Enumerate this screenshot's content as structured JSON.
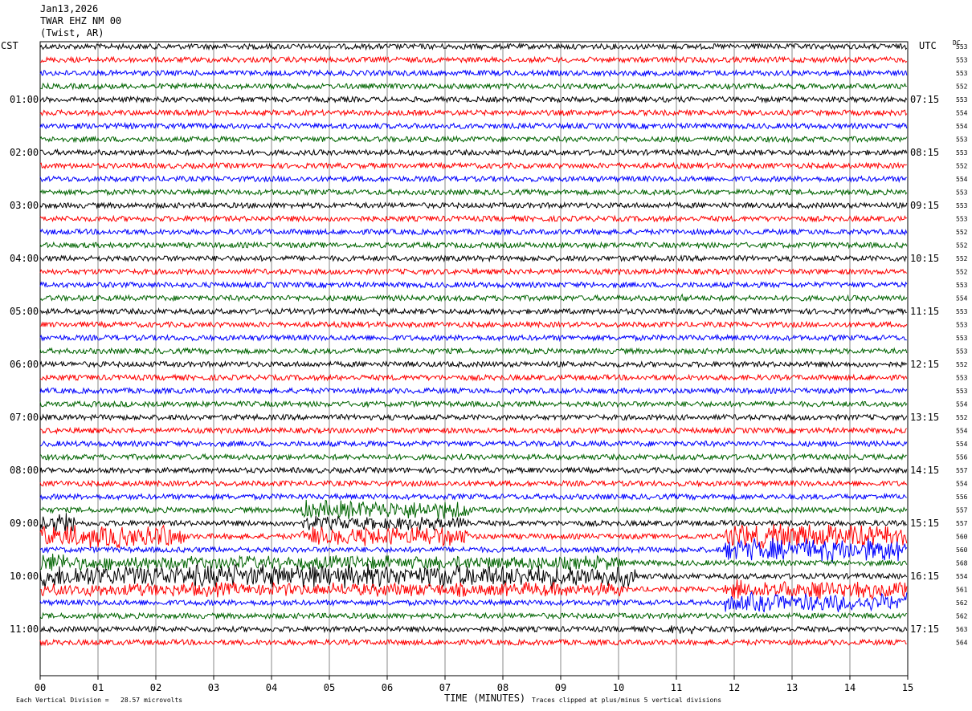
{
  "header": {
    "date": "Jan13,2026",
    "station": "TWAR EHZ NM 00",
    "location": "(Twist, AR)"
  },
  "left_axis_label": "CST",
  "right_axis_label": "UTC",
  "dc_label": "DC",
  "footer": {
    "scale": "Each Vertical Division =   28.57 microvolts",
    "xlabel": "TIME (MINUTES)",
    "clip_note": "Traces clipped at plus/minus 5 vertical divisions"
  },
  "colors": {
    "cycle": [
      "#000000",
      "#ff0000",
      "#0000ff",
      "#006400"
    ],
    "grid": "#888888"
  },
  "chart_data": {
    "type": "line",
    "xlim": [
      0,
      15
    ],
    "x_ticks": [
      "00",
      "01",
      "02",
      "03",
      "04",
      "05",
      "06",
      "07",
      "08",
      "09",
      "10",
      "11",
      "12",
      "13",
      "14",
      "15"
    ],
    "left_time_labels": [
      {
        "trace": 4,
        "label": "01:00"
      },
      {
        "trace": 8,
        "label": "02:00"
      },
      {
        "trace": 12,
        "label": "03:00"
      },
      {
        "trace": 16,
        "label": "04:00"
      },
      {
        "trace": 20,
        "label": "05:00"
      },
      {
        "trace": 24,
        "label": "06:00"
      },
      {
        "trace": 28,
        "label": "07:00"
      },
      {
        "trace": 32,
        "label": "08:00"
      },
      {
        "trace": 36,
        "label": "09:00"
      },
      {
        "trace": 40,
        "label": "10:00"
      },
      {
        "trace": 44,
        "label": "11:00"
      }
    ],
    "right_time_labels": [
      {
        "trace": 4,
        "label": "07:15"
      },
      {
        "trace": 8,
        "label": "08:15"
      },
      {
        "trace": 12,
        "label": "09:15"
      },
      {
        "trace": 16,
        "label": "10:15"
      },
      {
        "trace": 20,
        "label": "11:15"
      },
      {
        "trace": 24,
        "label": "12:15"
      },
      {
        "trace": 28,
        "label": "13:15"
      },
      {
        "trace": 32,
        "label": "14:15"
      },
      {
        "trace": 36,
        "label": "15:15"
      },
      {
        "trace": 40,
        "label": "16:15"
      },
      {
        "trace": 44,
        "label": "17:15"
      }
    ],
    "dc_offsets": [
      "553",
      "553",
      "553",
      "552",
      "553",
      "554",
      "554",
      "553",
      "553",
      "552",
      "554",
      "553",
      "553",
      "553",
      "552",
      "552",
      "552",
      "552",
      "553",
      "554",
      "553",
      "553",
      "553",
      "553",
      "552",
      "553",
      "553",
      "554",
      "552",
      "554",
      "554",
      "556",
      "557",
      "554",
      "556",
      "557",
      "557",
      "560",
      "560",
      "568",
      "554",
      "561",
      "562",
      "562",
      "563",
      "564"
    ],
    "activity_segments": [
      {
        "trace": 36,
        "start": 0,
        "end": 0.6,
        "amp": 5
      },
      {
        "trace": 37,
        "start": 0,
        "end": 2.5,
        "amp": 5
      },
      {
        "trace": 39,
        "start": 0,
        "end": 0.5,
        "amp": 5
      },
      {
        "trace": 39,
        "start": 0.5,
        "end": 10.1,
        "amp": 3
      },
      {
        "trace": 40,
        "start": 0,
        "end": 10.3,
        "amp": 5
      },
      {
        "trace": 41,
        "start": 0,
        "end": 10.1,
        "amp": 3
      },
      {
        "trace": 37,
        "start": 4.5,
        "end": 7.4,
        "amp": 4
      },
      {
        "trace": 35,
        "start": 4.5,
        "end": 7.4,
        "amp": 4
      },
      {
        "trace": 36,
        "start": 4.5,
        "end": 7.4,
        "amp": 3
      },
      {
        "trace": 37,
        "start": 11.85,
        "end": 15,
        "amp": 5
      },
      {
        "trace": 38,
        "start": 11.85,
        "end": 15,
        "amp": 5
      },
      {
        "trace": 41,
        "start": 11.85,
        "end": 15,
        "amp": 4
      },
      {
        "trace": 42,
        "start": 11.85,
        "end": 15,
        "amp": 4
      },
      {
        "trace": 20,
        "start": 5.85,
        "end": 5.95,
        "amp": 2
      },
      {
        "trace": 18,
        "start": 9.5,
        "end": 9.6,
        "amp": 1.5
      },
      {
        "trace": 19,
        "start": 11.1,
        "end": 11.2,
        "amp": 2
      },
      {
        "trace": 44,
        "start": 10.9,
        "end": 11.3,
        "amp": 2
      },
      {
        "trace": 27,
        "start": 0.8,
        "end": 1.8,
        "amp": 1.2
      }
    ]
  }
}
